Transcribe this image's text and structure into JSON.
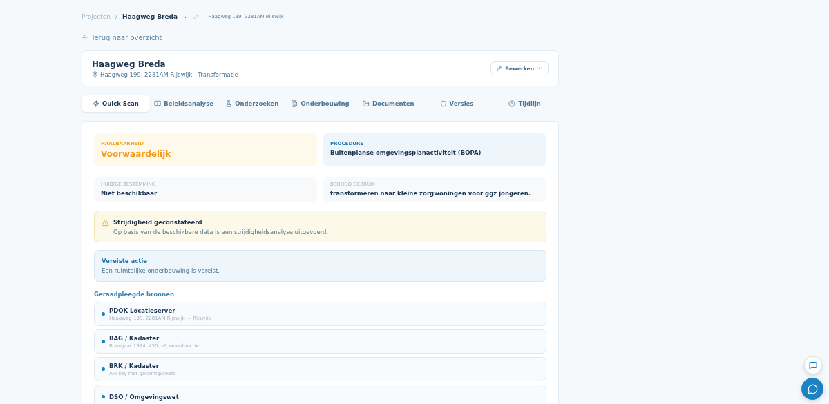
{
  "breadcrumb": {
    "root": "Projecten",
    "separator": "/",
    "current": "Haagweg Breda",
    "address": "Haagweg 199, 2281AM Rijswijk"
  },
  "back_link": "Terug naar overzicht",
  "project": {
    "title": "Haagweg Breda",
    "address": "Haagweg 199, 2281AM Rijswijk",
    "type": "Transformatie",
    "edit_button": "Bewerken"
  },
  "tabs": [
    {
      "label": "Quick Scan",
      "selected": true
    },
    {
      "label": "Beleidsanalyse",
      "selected": false
    },
    {
      "label": "Onderzoeken",
      "selected": false
    },
    {
      "label": "Onderbouwing",
      "selected": false
    },
    {
      "label": "Documenten",
      "selected": false
    },
    {
      "label": "Versies",
      "selected": false
    },
    {
      "label": "Tijdlijn",
      "selected": false
    }
  ],
  "summary": [
    {
      "kind": "warning",
      "label": "HAALBAARHEID",
      "value": "Voorwaardelijk"
    },
    {
      "kind": "info",
      "label": "PROCEDURE",
      "value": "Buitenplanse omgevingsplanactiviteit (BOPA)"
    },
    {
      "kind": "neutral",
      "label": "HUIDIGE BESTEMMING",
      "value": "Niet beschikbaar"
    },
    {
      "kind": "neutral",
      "label": "BEOOGD GEBRUIK",
      "value": "transformeren naar kleine zorgwoningen voor ggz jongeren."
    }
  ],
  "alerts": [
    {
      "kind": "warning",
      "title": "Strijdigheid geconstateerd",
      "text": "Op basis van de beschikbare data is een strijdigheidsanalyse uitgevoerd."
    },
    {
      "kind": "info",
      "title": "Vereiste actie",
      "text": "Een ruimtelijke onderbouwing is vereist."
    }
  ],
  "sources": {
    "title": "Geraadpleegde bronnen",
    "items": [
      {
        "name": "PDOK Locatieserver",
        "detail": "Haagweg 199, 2281AM Rijswijk — Rijswijk"
      },
      {
        "name": "BAG / Kadaster",
        "detail": "Bouwjaar 1924, 430 m², woonfunctie"
      },
      {
        "name": "BRK / Kadaster",
        "detail": "API key niet geconfigureerd"
      },
      {
        "name": "DSO / Omgevingswet"
      }
    ]
  }
}
